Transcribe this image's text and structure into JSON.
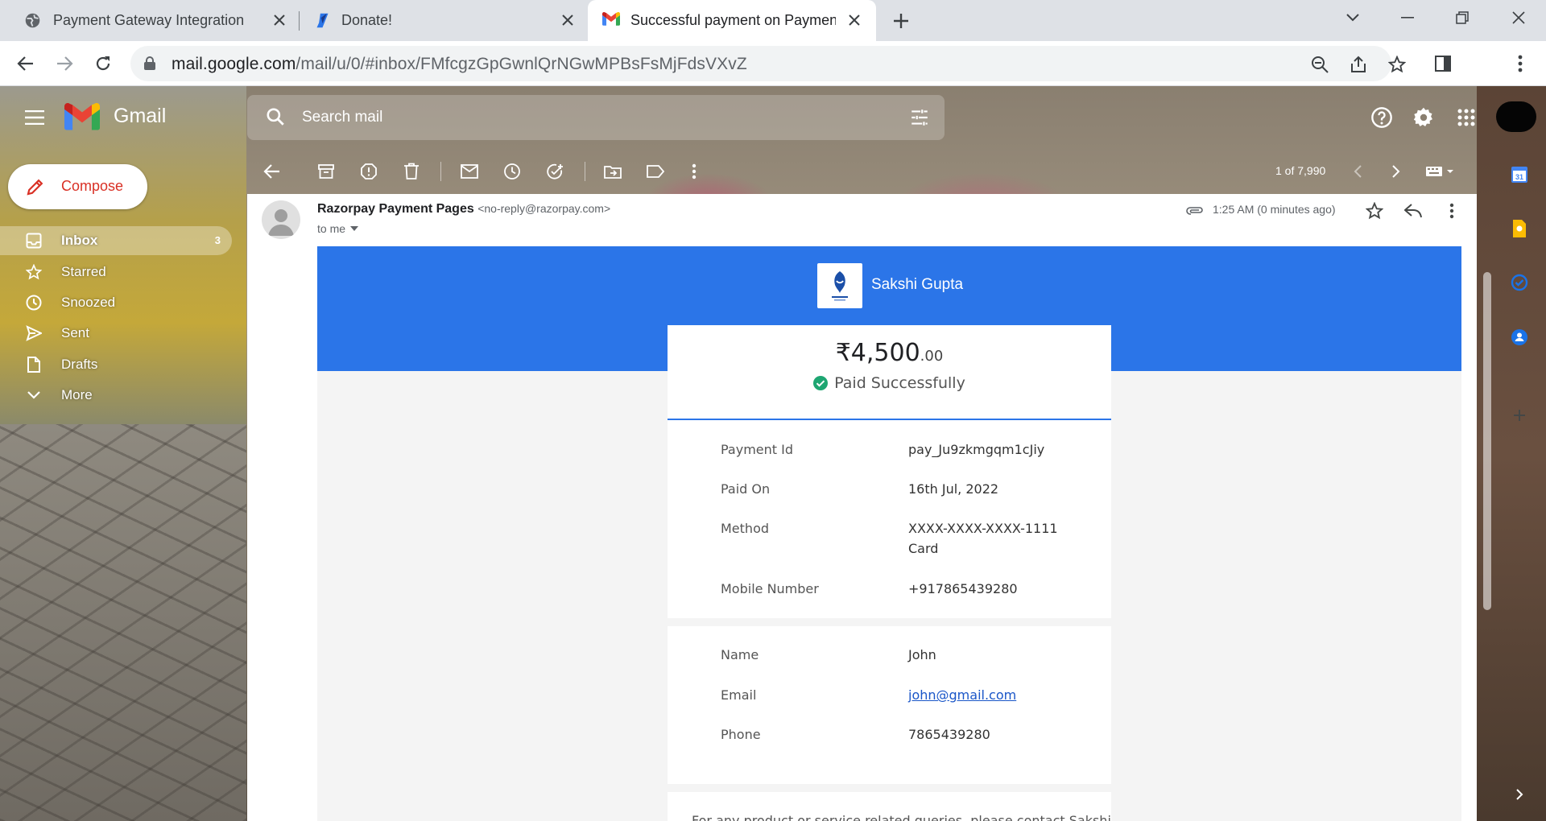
{
  "browser": {
    "tabs": [
      {
        "title": "Payment Gateway Integration",
        "favicon": "globe-icon",
        "active": false
      },
      {
        "title": "Donate!",
        "favicon": "razorpay-icon",
        "active": false
      },
      {
        "title": "Successful payment on Payment",
        "favicon": "gmail-icon",
        "active": true
      }
    ],
    "url_host": "mail.google.com",
    "url_path": "/mail/u/0/#inbox/FMfcgzGpGwnlQrNGwMPBsFsMjFdsVXvZ"
  },
  "gmail": {
    "logo_text": "Gmail",
    "search_placeholder": "Search mail",
    "compose_label": "Compose",
    "nav": [
      {
        "label": "Inbox",
        "count": "3",
        "icon": "inbox-icon",
        "active": true
      },
      {
        "label": "Starred",
        "count": "",
        "icon": "star-icon",
        "active": false
      },
      {
        "label": "Snoozed",
        "count": "",
        "icon": "clock-icon",
        "active": false
      },
      {
        "label": "Sent",
        "count": "",
        "icon": "send-icon",
        "active": false
      },
      {
        "label": "Drafts",
        "count": "",
        "icon": "draft-icon",
        "active": false
      },
      {
        "label": "More",
        "count": "",
        "icon": "chevron-down-icon",
        "active": false
      }
    ],
    "pager": "1 of 7,990"
  },
  "message": {
    "sender_name": "Razorpay Payment Pages",
    "sender_email": "<no-reply@razorpay.com>",
    "to": "to me",
    "time": "1:25 AM (0 minutes ago)"
  },
  "receipt": {
    "merchant": "Sakshi Gupta",
    "amount_main": "₹4,500",
    "amount_decimal": ".00",
    "status": "Paid Successfully",
    "details": [
      {
        "label": "Payment Id",
        "value": "pay_Ju9zkmgqm1cJiy"
      },
      {
        "label": "Paid On",
        "value": "16th Jul, 2022"
      },
      {
        "label": "Method",
        "value": "XXXX-XXXX-XXXX-1111",
        "value2": "Card"
      },
      {
        "label": "Mobile Number",
        "value": "+917865439280"
      }
    ],
    "customer": [
      {
        "label": "Name",
        "value": "John"
      },
      {
        "label": "Email",
        "value": "john@gmail.com"
      },
      {
        "label": "Phone",
        "value": "7865439280"
      }
    ],
    "footer": "For any product or service related queries, please contact Sakshi"
  },
  "colors": {
    "receipt_blue": "#2b75e8",
    "compose_red": "#d93025",
    "success_green": "#1ea672"
  }
}
